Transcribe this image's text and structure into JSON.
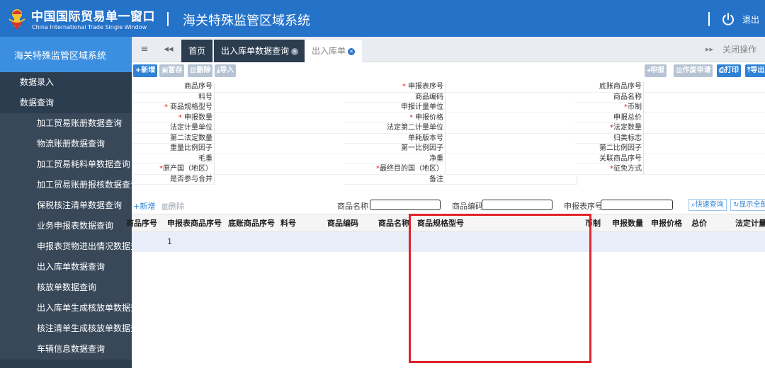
{
  "header": {
    "brand_cn": "中国国际贸易单一窗口",
    "brand_en": "China International Trade Single Window",
    "system_title": "海关特殊监管区域系统",
    "logout": "退出",
    "colors": {
      "banner": "#2572c9",
      "sidebar": "#2d3d50",
      "accent": "#3c8fe0",
      "highlight": "#e0242b"
    }
  },
  "sidebar": {
    "title": "海关特殊监管区域系统",
    "items": [
      {
        "label": "数据录入",
        "level": 1
      },
      {
        "label": "数据查询",
        "level": 1
      },
      {
        "label": "加工贸易账册数据查询",
        "level": 2
      },
      {
        "label": "物流账册数据查询",
        "level": 2
      },
      {
        "label": "加工贸易耗料单数据查询",
        "level": 2
      },
      {
        "label": "加工贸易账册报核数据查询",
        "level": 2
      },
      {
        "label": "保税核注清单数据查询",
        "level": 2
      },
      {
        "label": "业务申报表数据查询",
        "level": 2
      },
      {
        "label": "申报表货物进出情况数据查询",
        "level": 2
      },
      {
        "label": "出入库单数据查询",
        "level": 2
      },
      {
        "label": "核放单数据查询",
        "level": 2
      },
      {
        "label": "出入库单生成核放单数据查询",
        "level": 2
      },
      {
        "label": "核注清单生成核放单数据查询",
        "level": 2
      },
      {
        "label": "车辆信息数据查询",
        "level": 2
      }
    ]
  },
  "tabs": {
    "home": "首页",
    "query": "出入库单数据查询",
    "form": "出入库单",
    "close_ops": "关闭操作"
  },
  "toolbar": {
    "add": "新增",
    "save": "暂存",
    "delete": "删除",
    "import": "导入",
    "declare": "申报",
    "void_apply": "作废申请",
    "print": "打印",
    "export": "导出"
  },
  "form": {
    "rows": [
      [
        {
          "label": "商品序号",
          "req": false
        },
        {
          "label": "申报表序号",
          "req": true
        },
        {
          "label": "底账商品序号",
          "req": false
        }
      ],
      [
        {
          "label": "料号",
          "req": false
        },
        {
          "label": "商品编码",
          "req": false
        },
        {
          "label": "商品名称",
          "req": false
        }
      ],
      [
        {
          "label": "商品规格型号",
          "req": true
        },
        {
          "label": "申报计量单位",
          "req": false
        },
        {
          "label": "币制",
          "req": true
        }
      ],
      [
        {
          "label": "申报数量",
          "req": true
        },
        {
          "label": "申报价格",
          "req": true
        },
        {
          "label": "申报总价",
          "req": false
        }
      ],
      [
        {
          "label": "法定计量单位",
          "req": false
        },
        {
          "label": "法定第二计量单位",
          "req": false
        },
        {
          "label": "法定数量",
          "req": true
        }
      ],
      [
        {
          "label": "第二法定数量",
          "req": false
        },
        {
          "label": "单耗版本号",
          "req": false
        },
        {
          "label": "归类标志",
          "req": false
        }
      ],
      [
        {
          "label": "重量比例因子",
          "req": false
        },
        {
          "label": "第一比例因子",
          "req": false
        },
        {
          "label": "第二比例因子",
          "req": false
        }
      ],
      [
        {
          "label": "毛重",
          "req": false
        },
        {
          "label": "净重",
          "req": false
        },
        {
          "label": "关联商品序号",
          "req": false
        }
      ],
      [
        {
          "label": "原产国（地区）",
          "req": true
        },
        {
          "label": "最终目的国（地区）",
          "req": true
        },
        {
          "label": "征免方式",
          "req": true
        }
      ],
      [
        {
          "label": "是否参与合并",
          "req": false
        },
        {
          "label": "备注",
          "req": false
        },
        null
      ]
    ]
  },
  "list": {
    "add": "新增",
    "delete": "删除",
    "search_name_label": "商品名称",
    "search_code_label": "商品编码",
    "search_seq_label": "申报表序号",
    "quick_query": "快速查询",
    "show_all": "显示全部"
  },
  "table": {
    "columns": [
      "商品序号",
      "申报表商品序号",
      "底账商品序号",
      "料号",
      "商品编码",
      "商品名称",
      "商品规格型号",
      "币制",
      "申报数量",
      "申报价格",
      "总价",
      "法定计量"
    ],
    "rows": [
      {
        "seq": "",
        "decl_seq": "1"
      }
    ]
  }
}
